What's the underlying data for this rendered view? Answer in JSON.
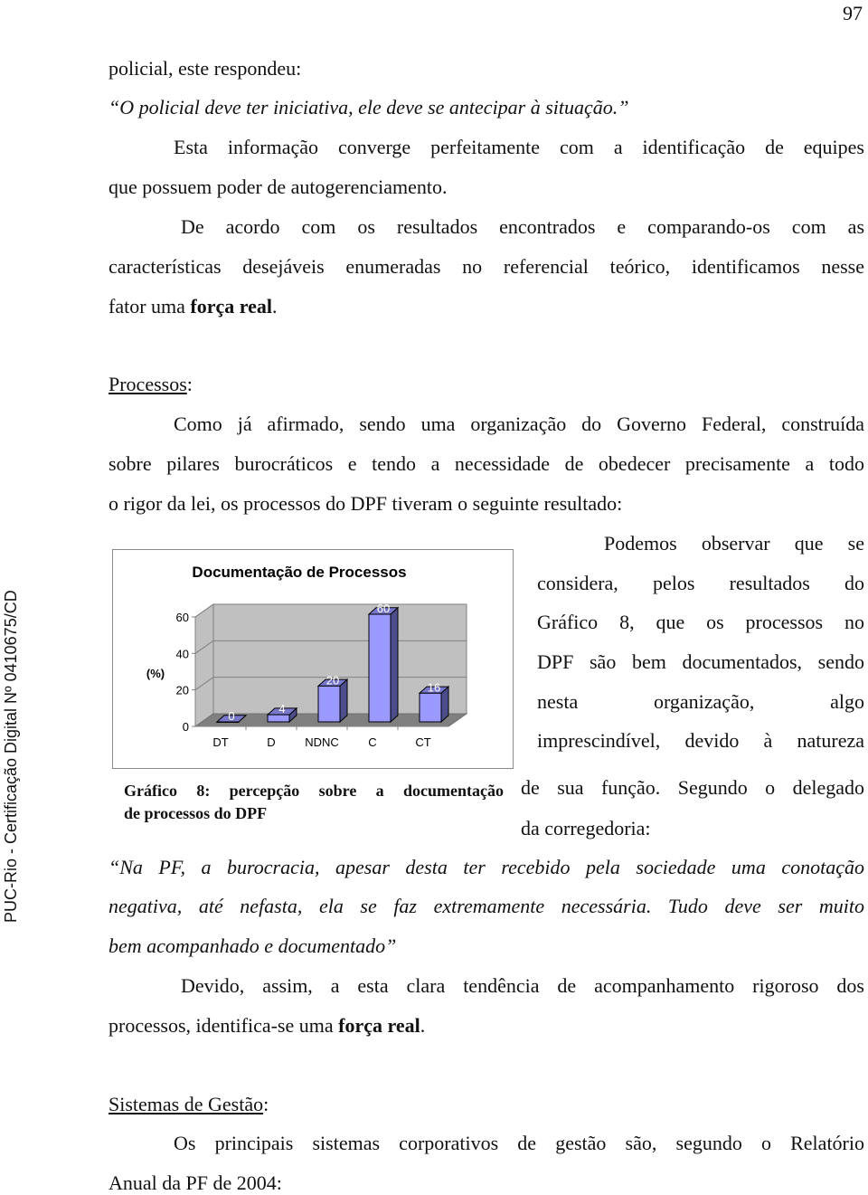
{
  "page_number": "97",
  "watermark": "PUC-Rio - Certificação Digital Nº 0410675/CD",
  "paragraphs": {
    "p1_line1": "policial, este respondeu:",
    "quote1": "“O policial deve ter iniciativa, ele deve se antecipar à situação.”",
    "p2_line1": "Esta informação converge perfeitamente com a identificação de equipes",
    "p2_line2": "que possuem poder de autogerenciamento.",
    "p3_line1": "De acordo com os resultados encontrados e comparando-os com as",
    "p3_line2": "características desejáveis enumeradas no referencial teórico, identificamos nesse",
    "p3_line3_pre": "fator uma ",
    "p3_line3_bold": "força real",
    "p3_line3_post": ".",
    "section1_heading": "Processos",
    "section1_colon": ":",
    "p4_line1": "Como já afirmado, sendo uma organização do Governo Federal, construída",
    "p4_line2": "sobre pilares burocráticos e tendo a necessidade de obedecer precisamente a todo",
    "p4_line3": "o rigor da lei, os processos do DPF tiveram o seguinte resultado:",
    "side_line1": "Podemos observar que se",
    "side_line2": "considera, pelos resultados do",
    "side_line3": "Gráfico 8, que os processos no",
    "side_line4": "DPF são bem documentados, sendo",
    "side_line5": "nesta organização, algo",
    "side_line6": "imprescindível, devido à natureza",
    "side_line7": "de sua função. Segundo o delegado",
    "side_line8": "da corregedoria:",
    "caption_line1": "Gráfico 8: percepção sobre a documentação",
    "caption_line2": "de processos do DPF",
    "quote2_line1": "“Na PF, a burocracia, apesar desta ter recebido pela sociedade uma conotação",
    "quote2_line2": "negativa, até nefasta, ela se faz extremamente necessária. Tudo deve ser muito",
    "quote2_line3": "bem acompanhado e documentado”",
    "p5_line1": "Devido, assim, a esta clara tendência de acompanhamento rigoroso dos",
    "p5_line2_pre": "processos, identifica-se uma ",
    "p5_line2_bold": "força real",
    "p5_line2_post": ".",
    "section2_heading": "Sistemas de Gestão",
    "section2_colon": ":",
    "p6_line1": "Os principais sistemas corporativos de gestão são, segundo o Relatório",
    "p6_line2": "Anual da PF de 2004:"
  },
  "chart_data": {
    "type": "bar",
    "style": "3d-column",
    "title": "Documentação de Processos",
    "xlabel": "",
    "ylabel": "(%)",
    "categories": [
      "DT",
      "D",
      "NDNC",
      "C",
      "CT"
    ],
    "values": [
      0,
      4,
      20,
      60,
      16
    ],
    "data_labels": [
      "0",
      "4",
      "20",
      "60",
      "16"
    ],
    "yticks": [
      "0",
      "20",
      "40",
      "60"
    ],
    "ylim": [
      0,
      60
    ],
    "grid": true,
    "legend": "none",
    "colors": {
      "bar_front": "#9999ff",
      "bar_side": "#4d4d8c",
      "bar_top": "#7777cc",
      "wall": "#c0c0c0",
      "floor": "#808080"
    }
  }
}
